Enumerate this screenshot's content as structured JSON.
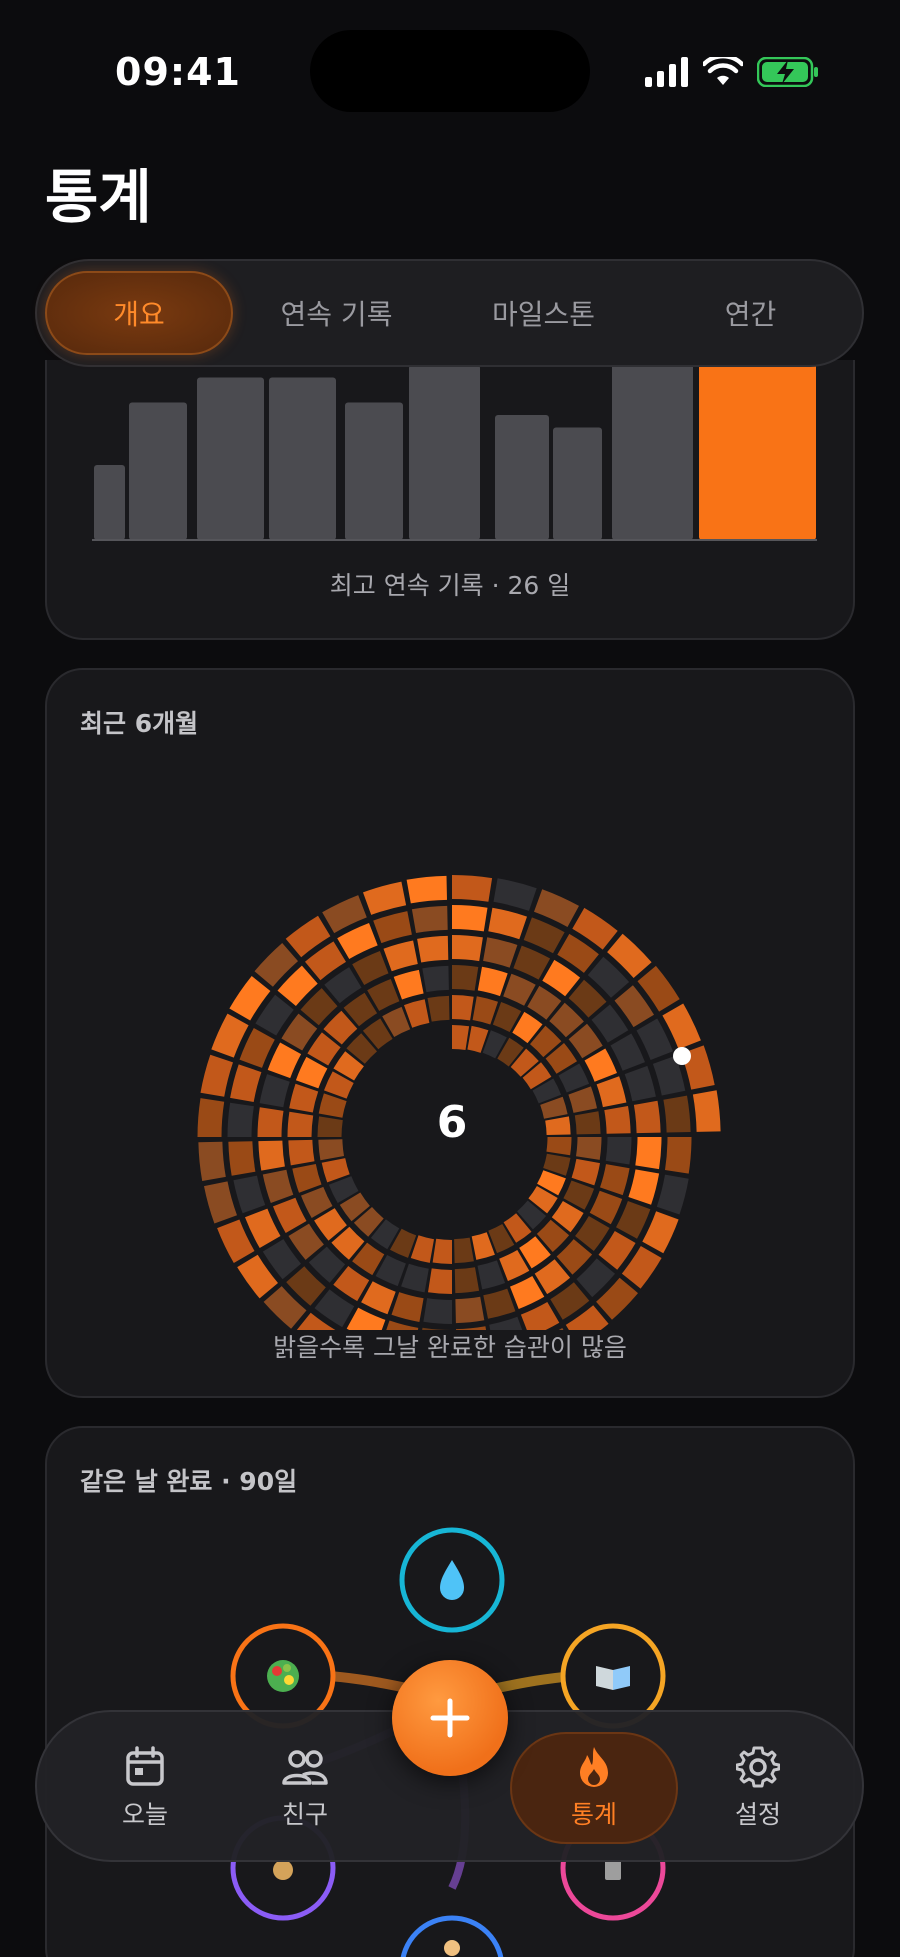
{
  "status": {
    "time": "09:41"
  },
  "header": {
    "title": "통계"
  },
  "tabs": [
    {
      "label": "개요",
      "active": true
    },
    {
      "label": "연속 기록",
      "active": false
    },
    {
      "label": "마일스톤",
      "active": false
    },
    {
      "label": "연간",
      "active": false
    }
  ],
  "streak_card": {
    "footer": "최고 연속 기록 · 26 일",
    "chart_data": {
      "type": "bar",
      "bar_values": [
        6,
        11,
        13,
        13,
        11,
        14,
        10,
        9,
        16,
        16
      ],
      "highlight_index": 9,
      "colors": {
        "normal": "#4b4b50",
        "highlight": "#f97316"
      }
    }
  },
  "heatmap_card": {
    "label": "최근 6개월",
    "center_value": "6",
    "footer": "밝을수록 그날 완료한 습관이 많음",
    "chart_data": {
      "type": "heatmap",
      "layout": "spiral",
      "months": 6
    }
  },
  "cooccur_card": {
    "label": "같은 날 완료 · 90일",
    "nodes": [
      {
        "icon": "water-drop-icon",
        "color": "#17b6d6"
      },
      {
        "icon": "salad-icon",
        "color": "#f97316"
      },
      {
        "icon": "book-icon",
        "color": "#f5a524"
      },
      {
        "icon": "meditation-icon",
        "color": "#8b5cf6"
      },
      {
        "icon": "notebook-icon",
        "color": "#ec4899"
      },
      {
        "icon": "running-icon",
        "color": "#3b82f6"
      }
    ]
  },
  "nav": {
    "items": [
      {
        "label": "오늘",
        "icon": "calendar-icon"
      },
      {
        "label": "친구",
        "icon": "friends-icon"
      },
      {
        "label": "통계",
        "icon": "flame-icon",
        "active": true
      },
      {
        "label": "설정",
        "icon": "gear-icon"
      }
    ],
    "fab": "add-icon"
  },
  "colors": {
    "accent": "#f97316",
    "background": "#0c0c0e",
    "card": "#18181b"
  }
}
